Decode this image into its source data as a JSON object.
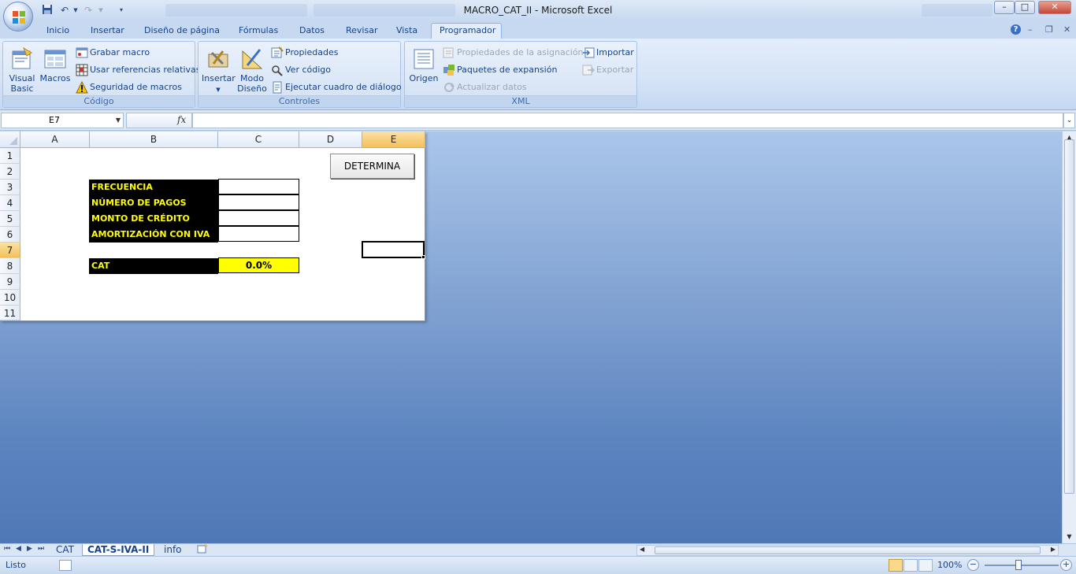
{
  "window": {
    "title": "MACRO_CAT_II - Microsoft Excel",
    "controls": {
      "minimize": "–",
      "maximize": "□",
      "close": "✕"
    }
  },
  "qat": {
    "save_icon": "save-icon",
    "undo_icon": "undo-icon",
    "redo_icon": "redo-icon",
    "customize_icon": "chevron-down-icon"
  },
  "tabs": {
    "items": [
      "Inicio",
      "Insertar",
      "Diseño de página",
      "Fórmulas",
      "Datos",
      "Revisar",
      "Vista",
      "Programador"
    ],
    "active": "Programador",
    "help": "?"
  },
  "ribbon": {
    "codigo": {
      "label": "Código",
      "visual_basic": "Visual\nBasic",
      "visual_basic_1": "Visual",
      "visual_basic_2": "Basic",
      "macros": "Macros",
      "grabar_macro": "Grabar macro",
      "usar_referencias": "Usar referencias relativas",
      "seguridad": "Seguridad de macros"
    },
    "controles": {
      "label": "Controles",
      "insertar": "Insertar",
      "modo_1": "Modo",
      "modo_2": "Diseño",
      "propiedades": "Propiedades",
      "ver_codigo": "Ver código",
      "ejecutar": "Ejecutar cuadro de diálogo"
    },
    "xml": {
      "label": "XML",
      "origen": "Origen",
      "propiedades_asignacion": "Propiedades de la asignación",
      "paquetes": "Paquetes de expansión",
      "actualizar": "Actualizar datos",
      "importar": "Importar",
      "exportar": "Exportar"
    }
  },
  "formula_bar": {
    "name_box": "E7",
    "fx": "fx",
    "formula": ""
  },
  "sheet": {
    "columns": [
      "A",
      "B",
      "C",
      "D",
      "E"
    ],
    "selected_column": "E",
    "rows": [
      "1",
      "2",
      "3",
      "4",
      "5",
      "6",
      "7",
      "8",
      "9",
      "10",
      "11"
    ],
    "selected_row": "7",
    "labels": {
      "frecuencia": "FRECUENCIA",
      "numero_pagos": "NÚMERO DE PAGOS",
      "monto_credito": "MONTO DE CRÉDITO",
      "amortizacion": "AMORTIZACIÓN CON IVA",
      "cat": "CAT"
    },
    "cat_value": "0.0%",
    "button": "DETERMINA"
  },
  "sheet_tabs": {
    "items": [
      "CAT",
      "CAT-S-IVA-II",
      "info"
    ],
    "active": "CAT-S-IVA-II"
  },
  "status": {
    "text": "Listo",
    "zoom": "100%"
  },
  "colors": {
    "label_bg": "#000000",
    "label_text": "#ffff00",
    "cat_fill": "#ffff00",
    "header_selected": "#f3c05a"
  }
}
